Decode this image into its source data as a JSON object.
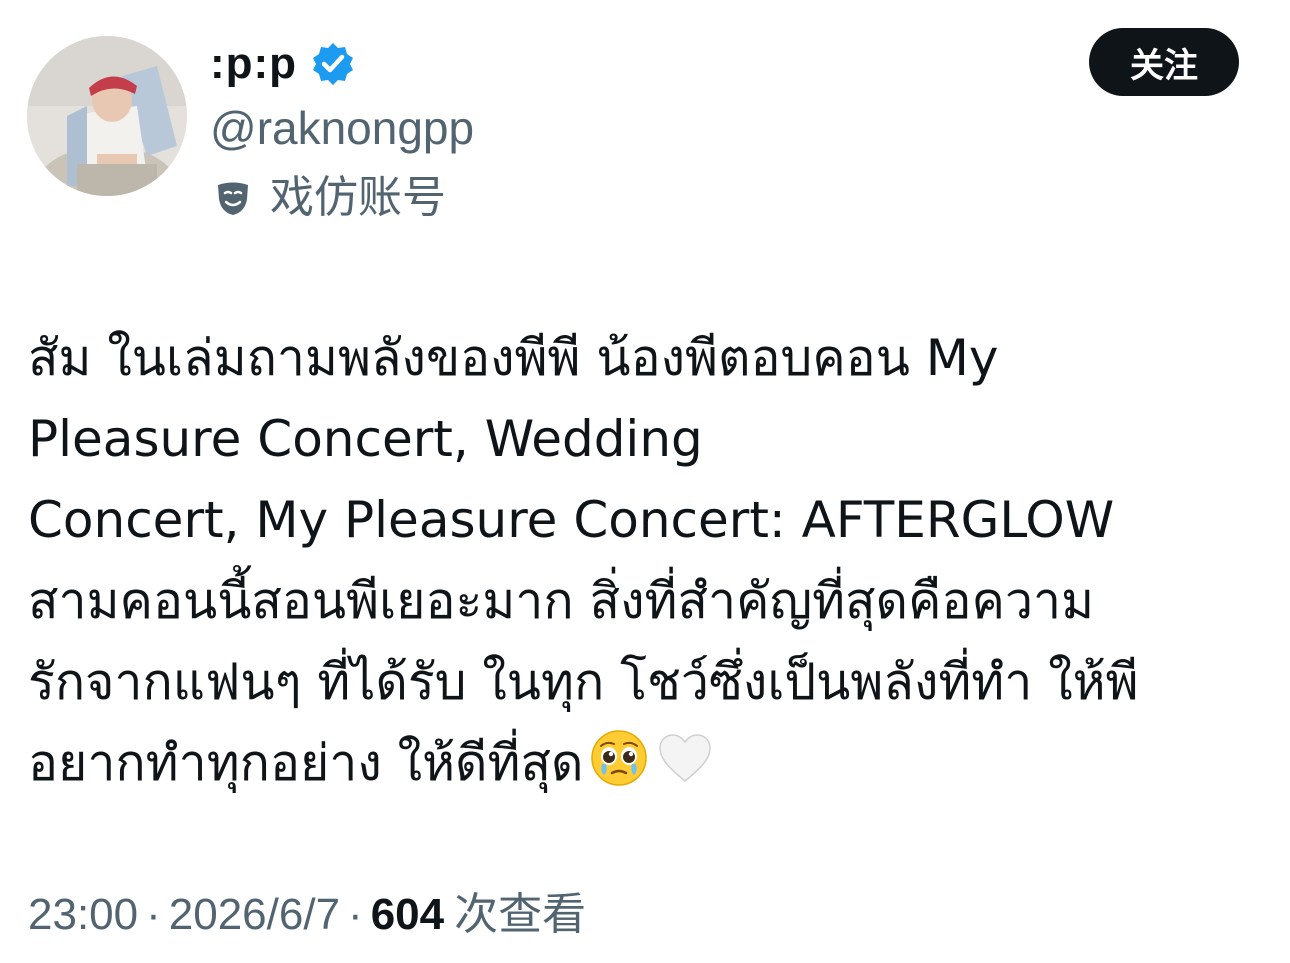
{
  "author": {
    "display_name": ":p:p",
    "handle": "@raknongpp",
    "account_label": "戏仿账号",
    "avatar_icon": "profile-photo",
    "verified_icon": "verified-badge-icon",
    "parody_icon": "theater-mask-icon"
  },
  "actions": {
    "follow_label": "关注"
  },
  "tweet": {
    "lines": [
      "สัม ในเล่มถามพลังของพีพี น้องพีตอบคอน My",
      "Pleasure Concert, Wedding",
      "Concert, My Pleasure Concert: AFTERGLOW",
      "สามคอนนี้สอนพีเยอะมาก สิ่งที่สำคัญที่สุดคือความ",
      "รักจากแฟนๆ ที่ได้รับ ในทุก โชว์ซึ่งเป็นพลังที่ทำ ให้พี",
      "อยากทำทุกอย่าง ให้ดีที่สุด"
    ],
    "emojis": [
      "pleading-face-emoji",
      "white-heart-emoji"
    ]
  },
  "meta": {
    "time": "23:00",
    "separator": "·",
    "date": "2026/6/7",
    "view_count": "604",
    "views_label": "次查看"
  },
  "colors": {
    "text_primary": "#0f1419",
    "text_secondary": "#536471",
    "verified_blue": "#1d9bf0",
    "button_bg": "#0f1419"
  }
}
